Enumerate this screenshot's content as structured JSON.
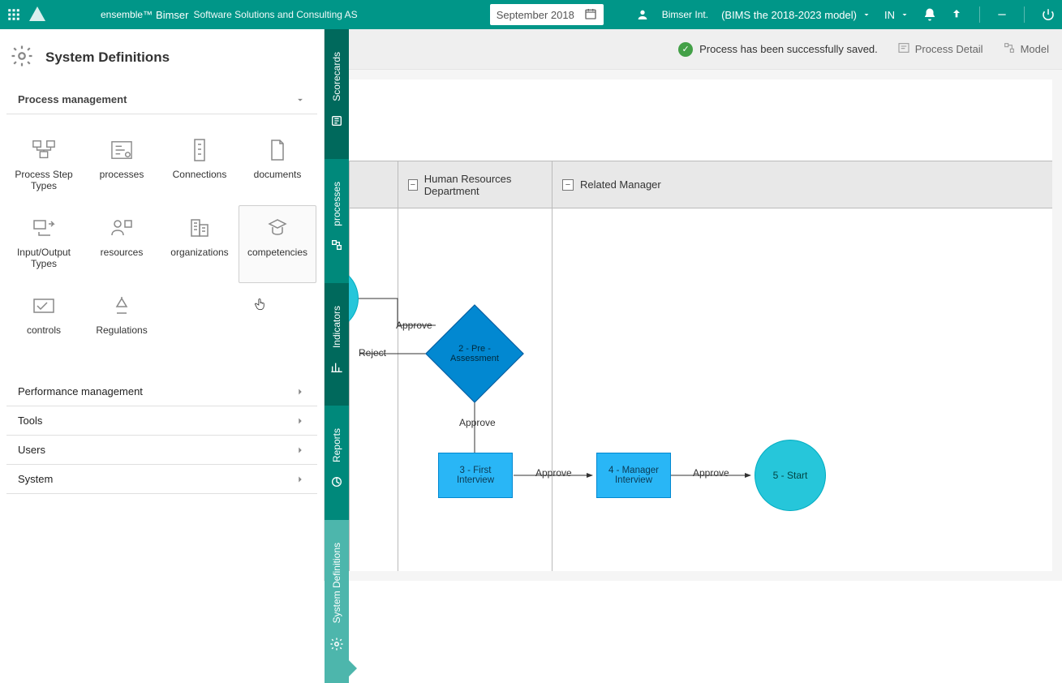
{
  "topbar": {
    "brand": "ensemble™",
    "company": "Bimser",
    "subcompany": "Software Solutions and Consulting AS",
    "date": "September 2018",
    "user_org": "Bimser Int.",
    "model": "(BIMS the 2018-2023 model)",
    "lang": "IN"
  },
  "sidebar": {
    "title": "System Definitions",
    "sections": {
      "process_mgmt": "Process management",
      "perf_mgmt": "Performance management",
      "tools": "Tools",
      "users": "Users",
      "system": "System"
    },
    "tiles": [
      {
        "name": "process-step-types",
        "label": "Process Step Types"
      },
      {
        "name": "processes",
        "label": "processes"
      },
      {
        "name": "connections",
        "label": "Connections"
      },
      {
        "name": "documents",
        "label": "documents"
      },
      {
        "name": "io-types",
        "label": "Input/Output Types"
      },
      {
        "name": "resources",
        "label": "resources"
      },
      {
        "name": "organizations",
        "label": "organizations"
      },
      {
        "name": "competencies",
        "label": "competencies"
      },
      {
        "name": "controls",
        "label": "controls"
      },
      {
        "name": "regulations",
        "label": "Regulations"
      }
    ]
  },
  "vtabs": [
    {
      "name": "scorecards",
      "label": "Scorecards"
    },
    {
      "name": "processes",
      "label": "processes"
    },
    {
      "name": "indicators",
      "label": "Indicators"
    },
    {
      "name": "reports",
      "label": "Reports"
    },
    {
      "name": "system-definitions",
      "label": "System Definitions"
    }
  ],
  "content": {
    "status_msg": "Process has been successfully saved.",
    "btn_detail": "Process Detail",
    "btn_model": "Model",
    "lanes": {
      "hr": "Human Resources Department",
      "manager": "Related Manager"
    },
    "nodes": {
      "n2": "2 - Pre - Assessment",
      "n3": "3 - First Interview",
      "n4": "4 - Manager Interview",
      "n5": "5 - Start"
    },
    "edges": {
      "approve": "Approve",
      "reject": "Reject"
    }
  }
}
